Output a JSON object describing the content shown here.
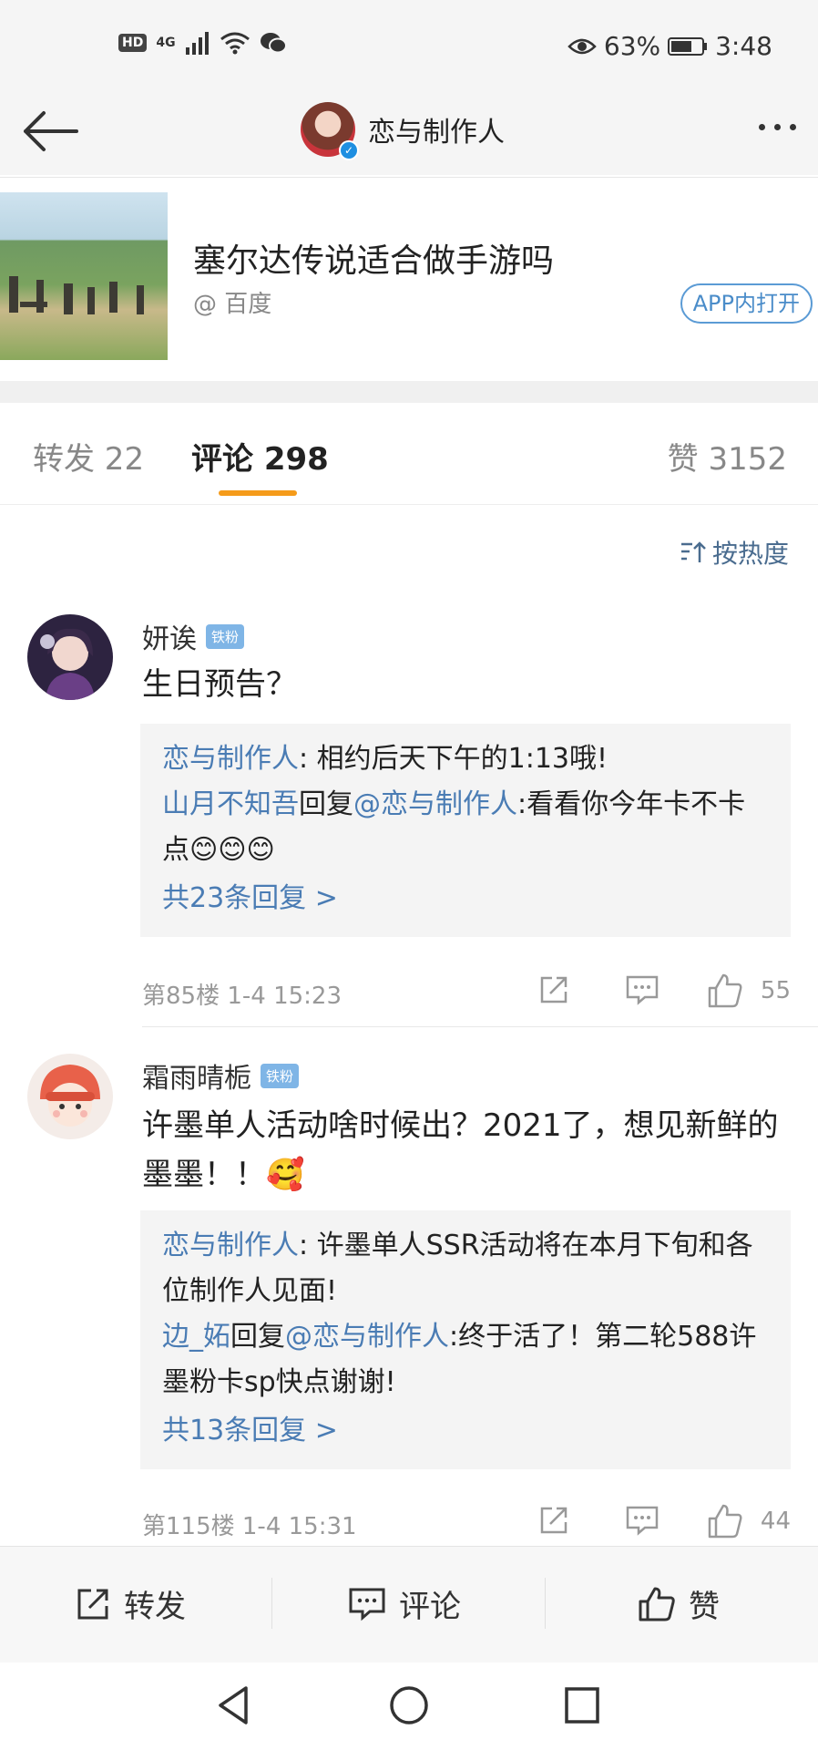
{
  "status_bar": {
    "hd": "HD",
    "network": "4G",
    "battery": "63%",
    "time": "3:48"
  },
  "nav": {
    "title": "恋与制作人"
  },
  "card": {
    "title": "塞尔达传说适合做手游吗",
    "source": "@ 百度",
    "open_app": "APP内打开"
  },
  "tabs": [
    {
      "label": "转发 22"
    },
    {
      "label": "评论 298"
    },
    {
      "label": "赞 3152"
    }
  ],
  "sort": {
    "label": "按热度"
  },
  "comments": [
    {
      "name": "妍诶",
      "badge": "铁粉",
      "text": "生日预告？",
      "replies": [
        {
          "author": "恋与制作人",
          "text": ": 相约后天下午的1:13哦!"
        },
        {
          "author": "山月不知吾",
          "mid": "回复",
          "target": "@恋与制作人",
          "text": ":看看你今年卡不卡点😊😊😊"
        }
      ],
      "more": "共23条回复 >",
      "meta": "第85楼  1-4 15:23",
      "likes": "55"
    },
    {
      "name": "霜雨晴栀",
      "badge": "铁粉",
      "text": "许墨单人活动啥时候出？2021了，想见新鲜的墨墨！！🥰",
      "replies": [
        {
          "author": "恋与制作人",
          "text": ": 许墨单人SSR活动将在本月下旬和各位制作人见面!"
        },
        {
          "author": "边_妬",
          "mid": "回复",
          "target": "@恋与制作人",
          "text": ":终于活了！第二轮588许墨粉卡sp快点谢谢!"
        }
      ],
      "more": "共13条回复 >",
      "meta": "第115楼  1-4 15:31",
      "likes": "44"
    }
  ],
  "bottom_bar": {
    "repost": "转发",
    "comment": "评论",
    "like": "赞"
  },
  "colors": {
    "accent": "#f59b1a",
    "link": "#4a7cb4",
    "badge": "#7fb5e6"
  }
}
